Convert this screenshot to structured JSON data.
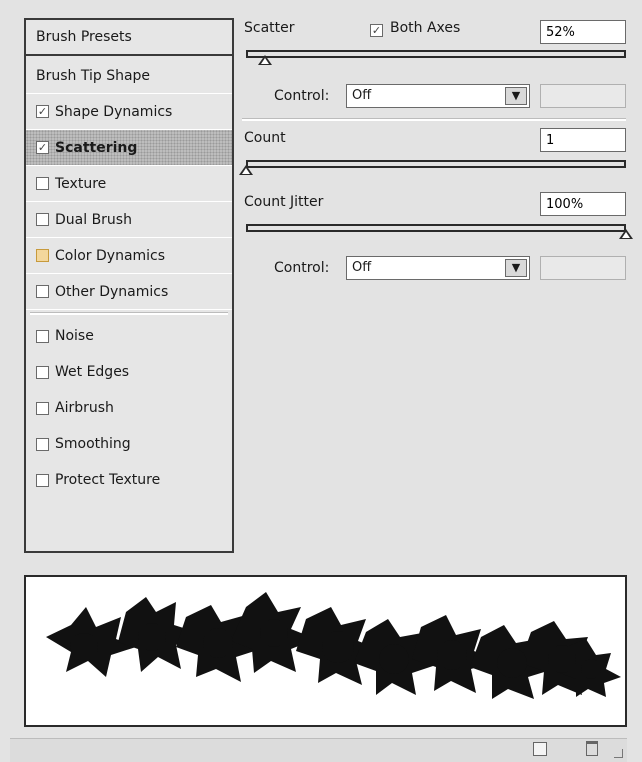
{
  "left_panel": {
    "header": "Brush Presets",
    "items": [
      {
        "label": "Brush Tip Shape",
        "checkbox": false
      },
      {
        "label": "Shape Dynamics",
        "checkbox": true,
        "checked": true
      },
      {
        "label": "Scattering",
        "checkbox": true,
        "checked": true,
        "selected": true
      },
      {
        "label": "Texture",
        "checkbox": true,
        "checked": false
      },
      {
        "label": "Dual Brush",
        "checkbox": true,
        "checked": false
      },
      {
        "label": "Color Dynamics",
        "checkbox": true,
        "checked": false,
        "locked": true
      },
      {
        "label": "Other Dynamics",
        "checkbox": true,
        "checked": false
      },
      {
        "label": "Noise",
        "checkbox": true,
        "checked": false
      },
      {
        "label": "Wet Edges",
        "checkbox": true,
        "checked": false
      },
      {
        "label": "Airbrush",
        "checkbox": true,
        "checked": false
      },
      {
        "label": "Smoothing",
        "checkbox": true,
        "checked": false
      },
      {
        "label": "Protect Texture",
        "checkbox": true,
        "checked": false
      }
    ]
  },
  "scatter": {
    "label": "Scatter",
    "both_axes_label": "Both Axes",
    "both_axes_checked": true,
    "value": "52%",
    "slider_fraction": 0.05
  },
  "scatter_control": {
    "label": "Control:",
    "value": "Off"
  },
  "count": {
    "label": "Count",
    "value": "1",
    "slider_fraction": 0.0
  },
  "count_jitter": {
    "label": "Count Jitter",
    "value": "100%",
    "slider_fraction": 1.0
  },
  "count_control": {
    "label": "Control:",
    "value": "Off"
  },
  "icons": {
    "checkmark": "✓",
    "dropdown": "▼",
    "new_preset": "new-preset-icon",
    "delete": "trash-icon"
  }
}
